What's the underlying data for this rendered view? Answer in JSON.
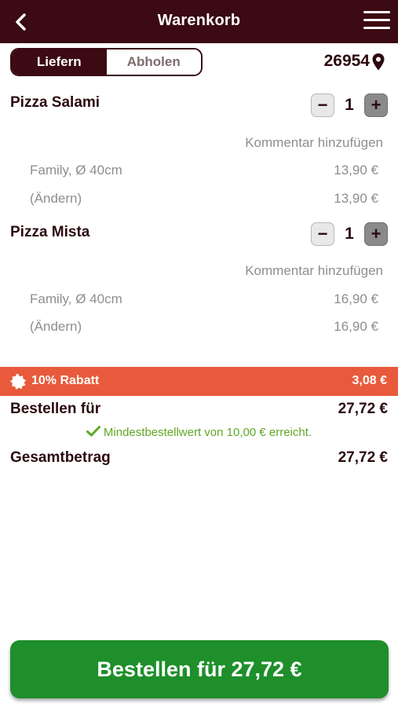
{
  "header": {
    "title": "Warenkorb",
    "back_icon": "chevron-left-icon",
    "menu_icon": "hamburger-menu-icon"
  },
  "delivery_mode": {
    "options": [
      "Liefern",
      "Abholen"
    ],
    "selected": "Liefern"
  },
  "location": {
    "zip": "26954",
    "icon": "map-pin-icon"
  },
  "cart": {
    "items": [
      {
        "name": "Pizza Salami",
        "quantity": "1",
        "comment_link": "Kommentar hinzufügen",
        "size": "Family, Ø 40cm",
        "size_price": "13,90 €",
        "change_link": "(Ändern)",
        "total": "13,90 €"
      },
      {
        "name": "Pizza Mista",
        "quantity": "1",
        "comment_link": "Kommentar hinzufügen",
        "size": "Family, Ø 40cm",
        "size_price": "16,90 €",
        "change_link": "(Ändern)",
        "total": "16,90 €"
      }
    ]
  },
  "discount": {
    "label": "10% Rabatt",
    "value": "3,08 €",
    "icon": "discount-badge-icon",
    "color": "#e85a3b"
  },
  "summary": {
    "order_for_label": "Bestellen für",
    "order_for_value": "27,72 €",
    "min_order_message": "Mindestbestellwert von 10,00 € erreicht.",
    "total_label": "Gesamtbetrag",
    "total_value": "27,72 €"
  },
  "checkout": {
    "button_label": "Bestellen für 27,72 €",
    "color": "#1e8f2a"
  },
  "colors": {
    "brand": "#3b0a12",
    "success": "#5fa825"
  }
}
